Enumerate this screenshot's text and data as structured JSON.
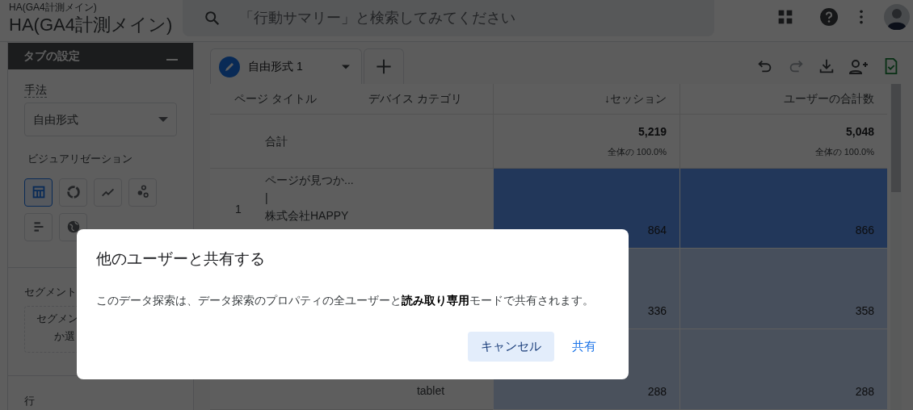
{
  "header": {
    "subtitle": "HA(GA4計測メイン)",
    "title": "HA(GA4計測メイン)",
    "search": {
      "placeholder": "「行動サマリー」と検索してみてください"
    }
  },
  "settings_panel": {
    "title": "タブの設定",
    "technique": {
      "label": "手法",
      "value": "自由形式"
    },
    "visualization": {
      "label": "ビジュアリゼーション",
      "options": [
        {
          "selected": true
        },
        {
          "selected": false
        },
        {
          "selected": false
        },
        {
          "selected": false
        },
        {
          "selected": false
        },
        {
          "selected": false
        }
      ]
    },
    "segment": {
      "label": "セグメント",
      "hint_lines": [
        "セグメン",
        "か選"
      ]
    },
    "rows_label": "行"
  },
  "tabs": [
    {
      "label": "自由形式 1",
      "selected": true
    }
  ],
  "table": {
    "columns": [
      "ページ タイトル",
      "デバイス カテゴリ",
      "↓セッション",
      "ユーザーの合計数"
    ],
    "total": {
      "label": "合計",
      "values": [
        {
          "value": "5,219",
          "share": "全体の 100.0%"
        },
        {
          "value": "5,048",
          "share": "全体の 100.0%"
        }
      ]
    },
    "rows": [
      {
        "index": "1",
        "page_title": [
          "ページが見つか...",
          "|",
          "株式会社HAPPY"
        ],
        "values": [
          {
            "value": "864",
            "color": "#22375a"
          },
          {
            "value": "866",
            "color": "#22375a"
          }
        ]
      },
      {
        "values": [
          {
            "value": "336",
            "color": "#48505c"
          },
          {
            "value": "358",
            "color": "#474f5c"
          }
        ]
      },
      {
        "device": "tablet",
        "values": [
          {
            "value": "288",
            "color": "#4a515c"
          },
          {
            "value": "288",
            "color": "#4a515c"
          }
        ]
      }
    ]
  },
  "dialog": {
    "title": "他のユーザーと共有する",
    "message": "このデータ探索は、データ探索のプロパティの全ユーザーと**読み取り専用**モードで共有されます。",
    "buttons": [
      {
        "label": "キャンセル",
        "kind": "tonal"
      },
      {
        "label": "共有",
        "kind": "text"
      }
    ]
  }
}
